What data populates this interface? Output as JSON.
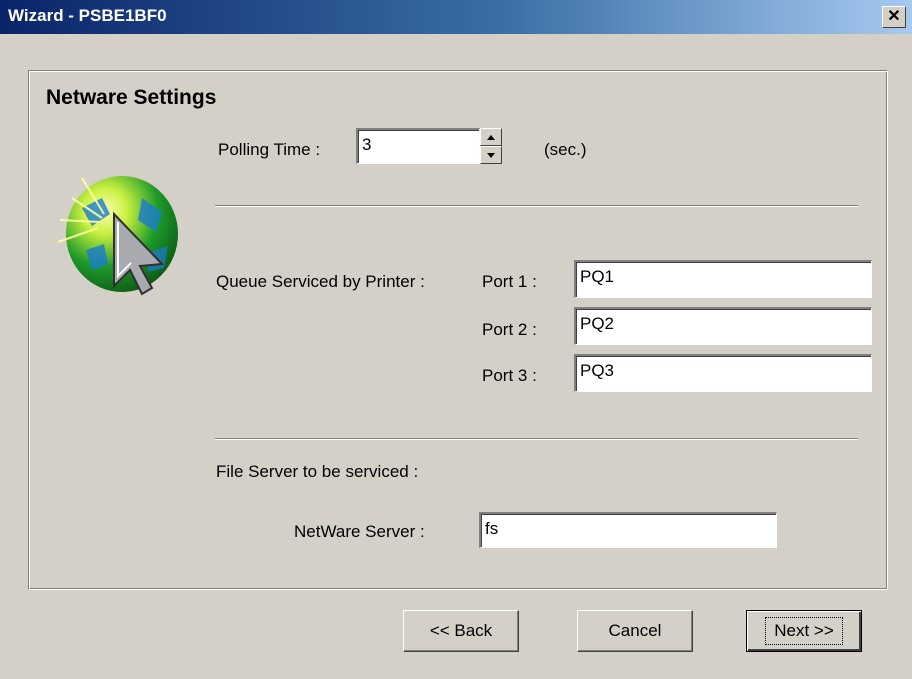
{
  "window": {
    "title": "Wizard - PSBE1BF0",
    "close_glyph": "✕"
  },
  "page": {
    "heading": "Netware Settings"
  },
  "polling": {
    "label": "Polling Time :",
    "value": "3",
    "unit": "(sec.)"
  },
  "queue": {
    "label": "Queue Serviced by Printer :",
    "ports": [
      {
        "label": "Port 1 :",
        "value": "PQ1"
      },
      {
        "label": "Port 2 :",
        "value": "PQ2"
      },
      {
        "label": "Port 3 :",
        "value": "PQ3"
      }
    ]
  },
  "file_server": {
    "label": "File Server to be serviced :"
  },
  "netware_server": {
    "label": "NetWare Server :",
    "value": "fs"
  },
  "buttons": {
    "back": "<< Back",
    "cancel": "Cancel",
    "next": "Next >>"
  },
  "icons": {
    "wizard": "globe-cursor-icon",
    "close": "close-icon"
  }
}
